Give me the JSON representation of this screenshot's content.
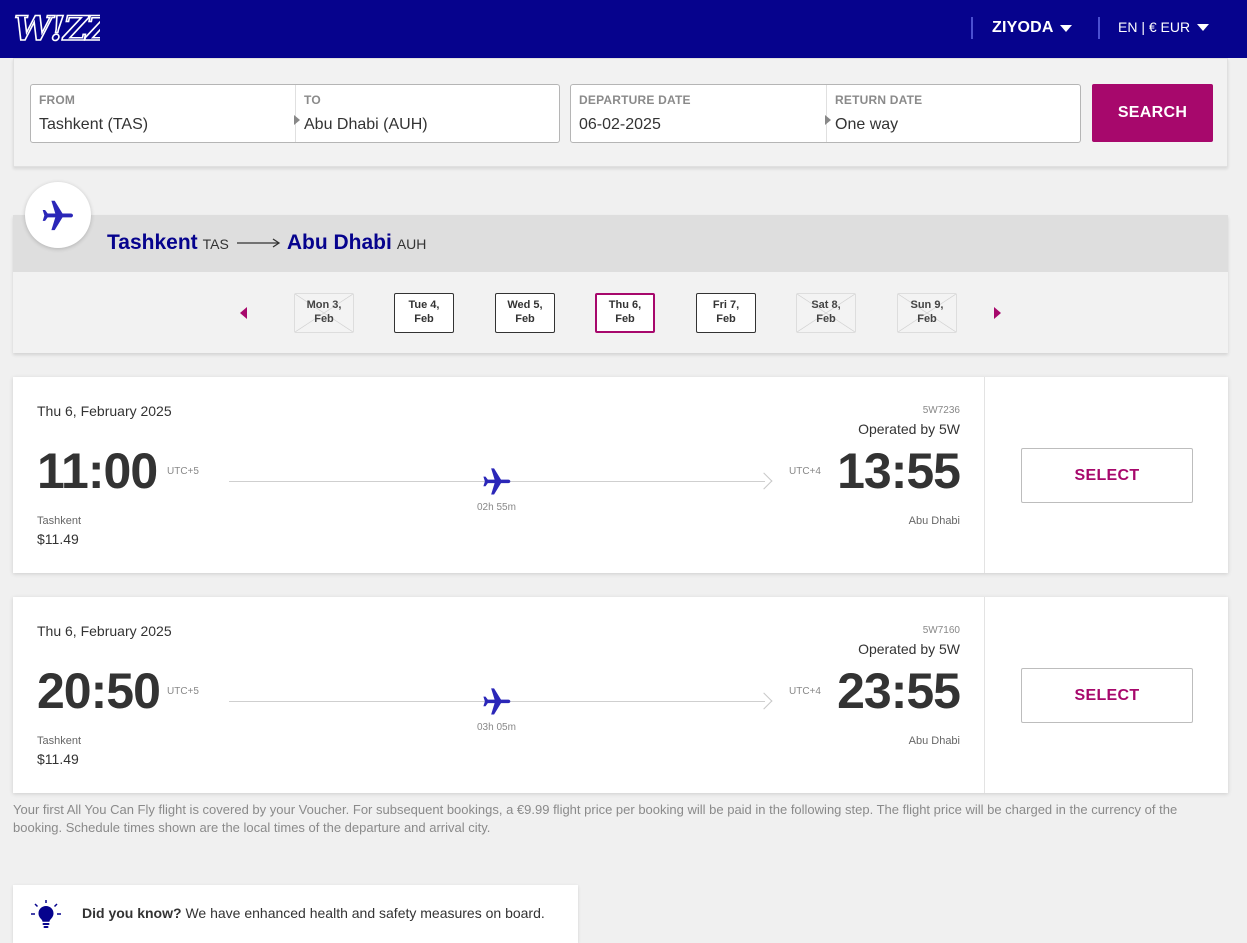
{
  "header": {
    "user_label": "ZIYODA",
    "lang_currency_label": "EN | € EUR"
  },
  "search": {
    "from_label": "FROM",
    "from_value": "Tashkent (TAS)",
    "to_label": "TO",
    "to_value": "Abu Dhabi (AUH)",
    "departure_label": "DEPARTURE DATE",
    "departure_value": "06-02-2025",
    "return_label": "RETURN DATE",
    "return_value": "One way",
    "search_button": "SEARCH"
  },
  "route": {
    "origin_city": "Tashkent",
    "origin_code": "TAS",
    "dest_city": "Abu Dhabi",
    "dest_code": "AUH"
  },
  "dates": [
    {
      "line1": "Mon 3,",
      "line2": "Feb",
      "state": "disabled"
    },
    {
      "line1": "Tue 4,",
      "line2": "Feb",
      "state": "available"
    },
    {
      "line1": "Wed 5,",
      "line2": "Feb",
      "state": "available"
    },
    {
      "line1": "Thu 6,",
      "line2": "Feb",
      "state": "selected"
    },
    {
      "line1": "Fri 7,",
      "line2": "Feb",
      "state": "available"
    },
    {
      "line1": "Sat 8,",
      "line2": "Feb",
      "state": "disabled"
    },
    {
      "line1": "Sun 9,",
      "line2": "Feb",
      "state": "disabled"
    }
  ],
  "flights": [
    {
      "date": "Thu 6, February 2025",
      "flight_no": "5W7236",
      "operated_by": "Operated by 5W",
      "dep_time": "11:00",
      "dep_utc": "UTC+5",
      "arr_time": "13:55",
      "arr_utc": "UTC+4",
      "duration": "02h 55m",
      "dep_city": "Tashkent",
      "arr_city": "Abu Dhabi",
      "price": "$11.49",
      "select_label": "SELECT"
    },
    {
      "date": "Thu 6, February 2025",
      "flight_no": "5W7160",
      "operated_by": "Operated by 5W",
      "dep_time": "20:50",
      "dep_utc": "UTC+5",
      "arr_time": "23:55",
      "arr_utc": "UTC+4",
      "duration": "03h 05m",
      "dep_city": "Tashkent",
      "arr_city": "Abu Dhabi",
      "price": "$11.49",
      "select_label": "SELECT"
    }
  ],
  "disclaimer": "Your first All You Can Fly flight is covered by your Voucher. For subsequent bookings, a €9.99 flight price per booking will be paid in the following step. The flight price will be charged in the currency of the booking. Schedule times shown are the local times of the departure and arrival city.",
  "tip": {
    "heading": "Did you know?",
    "text": " We have enhanced health and safety measures on board."
  },
  "colors": {
    "brand_navy": "#06038d",
    "brand_magenta": "#a7086c",
    "plane_icon": "#2b27b8"
  },
  "icons": [
    "wizz-logo",
    "chevron-down-icon",
    "airplane-icon",
    "arrow-right-icon",
    "lightbulb-icon"
  ]
}
